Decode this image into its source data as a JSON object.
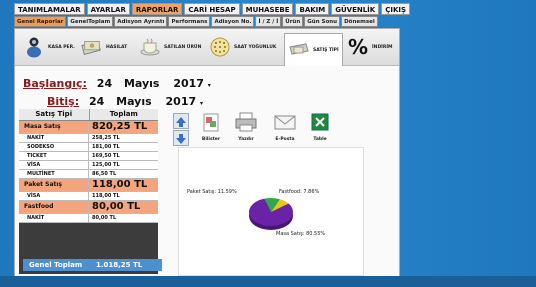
{
  "menu": [
    {
      "label": "TANIMLAMALAR",
      "active": false
    },
    {
      "label": "AYARLAR",
      "active": false
    },
    {
      "label": "RAPORLAR",
      "active": true
    },
    {
      "label": "CARİ HESAP",
      "active": false
    },
    {
      "label": "MUHASEBE",
      "active": false
    },
    {
      "label": "BAKIM",
      "active": false
    },
    {
      "label": "GÜVENLİK",
      "active": false
    },
    {
      "label": "ÇIKIŞ",
      "active": false
    }
  ],
  "subtabs": [
    {
      "label": "Genel Raporlar",
      "active": true
    },
    {
      "label": "GenelToplam",
      "active": false
    },
    {
      "label": "Adisyon Ayrıntı",
      "active": false
    },
    {
      "label": "Performans",
      "active": false
    },
    {
      "label": "Adisyon No.",
      "active": false
    },
    {
      "label": "İ / Z / İ",
      "active": false
    },
    {
      "label": "Ürün",
      "active": false
    },
    {
      "label": "Gün Sonu",
      "active": false
    },
    {
      "label": "Dönemsel",
      "active": false
    }
  ],
  "toolbar": [
    {
      "label": "KASA PER.",
      "icon": "cashier-icon"
    },
    {
      "label": "HASILAT",
      "icon": "money-icon"
    },
    {
      "label": "SATILAN ÜRÜN",
      "icon": "coffee-icon"
    },
    {
      "label": "SAAT YOĞUNLUK",
      "icon": "clock-icon"
    },
    {
      "label": "SATIŞ TİPİ",
      "icon": "cup-icon",
      "selected": true
    },
    {
      "label": "İNDİRİM",
      "icon": "percent-icon"
    }
  ],
  "dates": {
    "start_label": "Başlangıç:",
    "start_day": "24",
    "start_month": "Mayıs",
    "start_year": "2017",
    "end_label": "Bitiş:",
    "end_day": "24",
    "end_month": "Mayıs",
    "end_year": "2017"
  },
  "grid": {
    "headers": [
      "Satış Tipi",
      "Toplam"
    ],
    "rows": [
      {
        "type": "group",
        "name": "Masa Satış",
        "total": "820,25 TL"
      },
      {
        "type": "item",
        "name": "NAKİT",
        "total": "258,25 TL"
      },
      {
        "type": "item",
        "name": "SODEKSO",
        "total": "181,00 TL"
      },
      {
        "type": "item",
        "name": "TICKET",
        "total": "169,50 TL"
      },
      {
        "type": "item",
        "name": "VİSA",
        "total": "125,00 TL"
      },
      {
        "type": "item",
        "name": "MULTİNET",
        "total": "86,50 TL"
      },
      {
        "type": "group",
        "name": "Paket Satış",
        "total": "118,00 TL"
      },
      {
        "type": "item",
        "name": "VİSA",
        "total": "118,00 TL"
      },
      {
        "type": "group",
        "name": "Fastfood",
        "total": "80,00 TL"
      },
      {
        "type": "item",
        "name": "NAKİT",
        "total": "80,00 TL"
      }
    ],
    "total_label": "Genel Toplam",
    "total_value": "1.018,25 TL"
  },
  "actions": [
    {
      "label": "Bilister",
      "icon": "list-icon"
    },
    {
      "label": "Yazdır",
      "icon": "printer-icon"
    },
    {
      "label": "E-Posta",
      "icon": "email-icon"
    },
    {
      "label": "Table",
      "icon": "excel-icon"
    }
  ],
  "chart_data": {
    "type": "pie",
    "slices": [
      {
        "label": "Masa Satış: 80.55%",
        "value": 80.55,
        "color": "#6a22a6"
      },
      {
        "label": "Paket Satış: 11.59%",
        "value": 11.59,
        "color": "#2fa84a"
      },
      {
        "label": "Fastfood: 7.86%",
        "value": 7.86,
        "color": "#e8c81c"
      }
    ]
  }
}
